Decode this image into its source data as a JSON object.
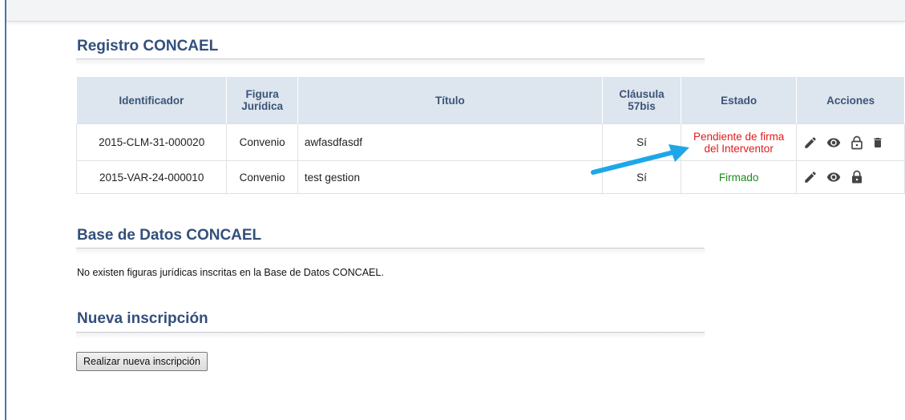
{
  "registro": {
    "title": "Registro CONCAEL",
    "headers": {
      "identificador": "Identificador",
      "figura_line1": "Figura",
      "figura_line2": "Jurídica",
      "titulo": "Título",
      "clausula_line1": "Cláusula",
      "clausula_line2": "57bis",
      "estado": "Estado",
      "acciones": "Acciones"
    },
    "rows": [
      {
        "identificador": "2015-CLM-31-000020",
        "figura": "Convenio",
        "titulo": "awfasdfasdf",
        "clausula": "Sí",
        "estado_line1": "Pendiente de firma",
        "estado_line2": "del Interventor",
        "estado_color": "#e01b1b",
        "actions": [
          "pencil-icon",
          "eye-icon",
          "unlock-icon",
          "trash-icon"
        ]
      },
      {
        "identificador": "2015-VAR-24-000010",
        "figura": "Convenio",
        "titulo": "test gestion",
        "clausula": "Sí",
        "estado_line1": "Firmado",
        "estado_color": "#1f8a1f",
        "actions": [
          "pencil-icon",
          "eye-icon",
          "lock-icon"
        ]
      }
    ]
  },
  "base_datos": {
    "title": "Base de Datos CONCAEL",
    "message": "No existen figuras jurídicas inscritas en la Base de Datos CONCAEL."
  },
  "nueva": {
    "title": "Nueva inscripción",
    "button_label": "Realizar nueva inscripción"
  },
  "colors": {
    "title": "#334f7c",
    "header_bg": "#dde5ee",
    "arrow": "#1ea7e8"
  }
}
